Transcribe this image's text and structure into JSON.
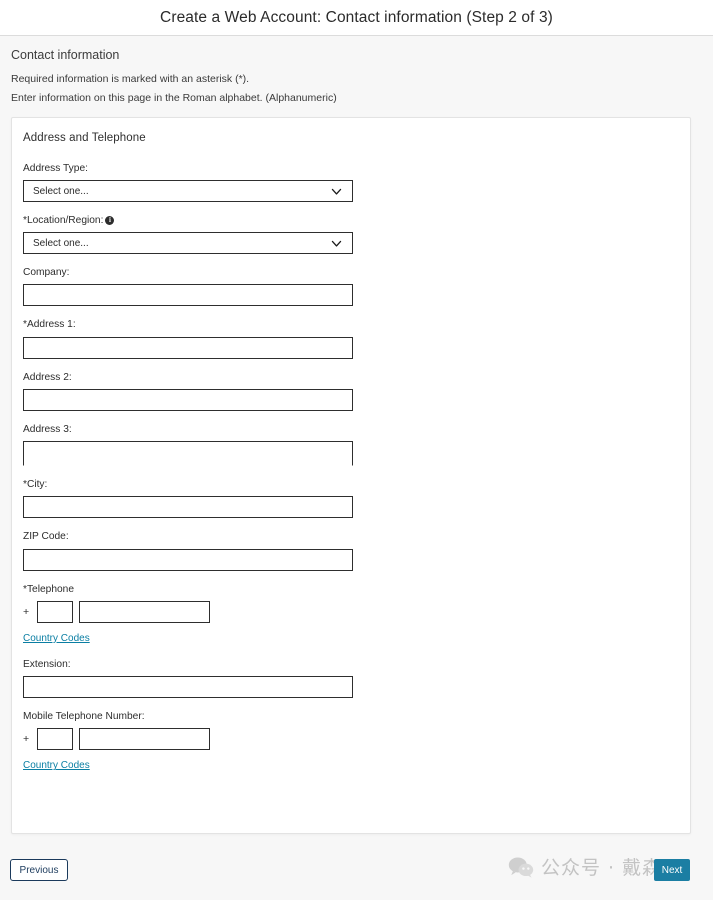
{
  "header": {
    "title": "Create a Web Account: Contact information (Step 2 of 3)"
  },
  "page": {
    "section_heading": "Contact information",
    "helper_text_1": "Required information is marked with an asterisk (*).",
    "helper_text_2": "Enter information on this page in the Roman alphabet. (Alphanumeric)"
  },
  "card": {
    "title": "Address and Telephone",
    "fields": {
      "address_type": {
        "label": "Address Type:",
        "selected": "Select one...",
        "icon": "chevron-down-icon"
      },
      "location_region": {
        "label": "*Location/Region:",
        "selected": "Select one...",
        "info_icon": "info-icon",
        "info_glyph": "i",
        "icon": "chevron-down-icon"
      },
      "company": {
        "label": "Company:",
        "value": ""
      },
      "address1": {
        "label": "*Address 1:",
        "value": ""
      },
      "address2": {
        "label": "Address 2:",
        "value": ""
      },
      "address3": {
        "label": "Address 3:",
        "value": ""
      },
      "city": {
        "label": "*City:",
        "value": ""
      },
      "zip_code": {
        "label": "ZIP Code:",
        "value": ""
      },
      "telephone": {
        "label": "*Telephone",
        "plus": "+",
        "country_code": "",
        "number": "",
        "link": "Country Codes"
      },
      "extension": {
        "label": "Extension:",
        "value": ""
      },
      "mobile_telephone": {
        "label": "Mobile Telephone Number:",
        "plus": "+",
        "country_code": "",
        "number": "",
        "link": "Country Codes"
      }
    }
  },
  "footer": {
    "previous_label": "Previous",
    "next_label": "Next"
  },
  "watermark": {
    "text": "公众号 · 戴森云",
    "icon": "wechat-icon"
  },
  "colors": {
    "accent_teal": "#1b7ea3",
    "link_teal": "#0a7ea3",
    "button_navy": "#1b3a5c",
    "page_background": "#f7f7f7",
    "card_background": "#ffffff"
  }
}
